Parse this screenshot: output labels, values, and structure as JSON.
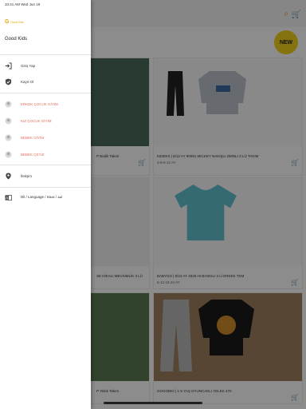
{
  "status_bar": {
    "time_date": "10:41 AM   Wed Jun 19"
  },
  "drawer": {
    "logo_mark": "G",
    "logo_text": "Good Kids",
    "brand_name": "Good Kids",
    "items": [
      {
        "label": "Giriş Yap",
        "icon": "login-icon"
      },
      {
        "label": "Kayıt Ol",
        "icon": "shield-check-icon"
      },
      {
        "label": "ERKEK ÇOCUK GİYİM",
        "icon": "category-circle-icon"
      },
      {
        "label": "KIZ ÇOCUK GİYİM",
        "icon": "category-circle-icon"
      },
      {
        "label": "BEBEK GİYİM",
        "icon": "category-circle-icon"
      },
      {
        "label": "BEBEK ÇEYİZ",
        "icon": "category-circle-icon"
      },
      {
        "label": "İletişim",
        "icon": "location-pin-icon"
      },
      {
        "label": "Dil / Language / язык / ﻟﻐﺔ",
        "icon": "translate-icon"
      }
    ]
  },
  "store": {
    "new_badge": "NEW",
    "products": [
      {
        "title": "P Bodili Takım",
        "price": "",
        "partial": true
      },
      {
        "title": "KIDEKS | 5/12 AY 90081 MICKEY NAKIŞLI 250NLI 3 LÜ TAKIM",
        "price": "3-6-9-12 AY"
      },
      {
        "title": "SE HİKALI MEVSİMLİK 3 LÜ",
        "price": "",
        "partial": true
      },
      {
        "title": "BABYGO | 6/24 AY 3326 HI BASKILI 2 Lİ ERKEK TKM",
        "price": "6-12-18-24 AY"
      },
      {
        "title": "P Yelek Takım",
        "price": "",
        "partial": true
      },
      {
        "title": "GOGOBIO | 1-5 YAŞ OYUNCAKLI YELEK 470",
        "price": ""
      }
    ]
  },
  "colors": {
    "accent": "#e3a600",
    "badge": "#f3d21c",
    "tshirt": "#63c1cf"
  }
}
